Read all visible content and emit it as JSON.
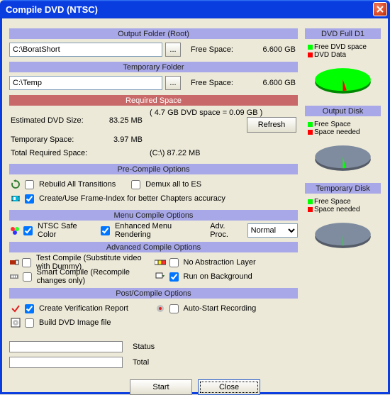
{
  "window": {
    "title": "Compile DVD (NTSC)"
  },
  "sections": {
    "output_folder": "Output Folder (Root)",
    "temp_folder": "Temporary Folder",
    "required_space": "Required Space",
    "pre_compile": "Pre-Compile Options",
    "menu_compile": "Menu Compile Options",
    "adv_compile": "Advanced Compile Options",
    "post_compile": "Post/Compile Options",
    "dvd_full": "DVD Full D1",
    "output_disk": "Output Disk",
    "temp_disk": "Temporary Disk"
  },
  "output_folder": {
    "path": "C:\\BoratShort",
    "free_space_label": "Free Space:",
    "free_space_value": "6.600 GB"
  },
  "temp_folder": {
    "path": "C:\\Temp",
    "free_space_label": "Free Space:",
    "free_space_value": "6.600 GB"
  },
  "required": {
    "est_label": "Estimated DVD Size:",
    "est_value": "83.25 MB",
    "est_extra": "( 4.7 GB DVD space = 0.09 GB )",
    "temp_label": "Temporary Space:",
    "temp_value": "3.97 MB",
    "total_label": "Total Required Space:",
    "total_value": "(C:\\) 87.22 MB",
    "refresh": "Refresh"
  },
  "pre": {
    "rebuild": "Rebuild All Transitions",
    "demux": "Demux all to ES",
    "frameindex": "Create/Use Frame-Index for better Chapters accuracy"
  },
  "menu": {
    "ntsc_safe": "NTSC Safe Color",
    "enh_render": "Enhanced Menu Rendering",
    "adv_proc_label": "Adv. Proc.",
    "adv_proc_value": "Normal"
  },
  "adv": {
    "test_compile": "Test Compile (Substitute video with Dummy)",
    "smart_compile": "Smart Compile (Recompile changes only)",
    "no_abstr": "No Abstraction Layer",
    "run_bg": "Run on Background"
  },
  "post": {
    "verif": "Create Verification Report",
    "autostart": "Auto-Start Recording",
    "build_iso": "Build DVD Image file"
  },
  "progress": {
    "status_label": "Status",
    "total_label": "Total"
  },
  "buttons": {
    "start": "Start",
    "close": "Close"
  },
  "legend": {
    "dvd_full_a": "Free DVD space",
    "dvd_full_b": "DVD Data",
    "out_a": "Free Space",
    "out_b": "Space needed",
    "tmp_a": "Free Space",
    "tmp_b": "Space needed"
  },
  "chart_data": [
    {
      "type": "pie",
      "title": "DVD Full D1",
      "series": [
        {
          "name": "Free DVD space",
          "value": 98.1,
          "color": "#00ff00"
        },
        {
          "name": "DVD Data",
          "value": 1.9,
          "color": "#ff0000"
        }
      ]
    },
    {
      "type": "pie",
      "title": "Output Disk",
      "series": [
        {
          "name": "Free Space",
          "value": 98.7,
          "color": "#7f8ca0"
        },
        {
          "name": "Space needed",
          "value": 1.3,
          "color": "#00ff00"
        }
      ]
    },
    {
      "type": "pie",
      "title": "Temporary Disk",
      "series": [
        {
          "name": "Free Space",
          "value": 99.9,
          "color": "#7f8ca0"
        },
        {
          "name": "Space needed",
          "value": 0.1,
          "color": "#00ff00"
        }
      ]
    }
  ],
  "checks": {
    "rebuild": false,
    "demux": false,
    "frameindex": true,
    "ntsc_safe": true,
    "enh_render": true,
    "test_compile": false,
    "smart_compile": false,
    "no_abstr": false,
    "run_bg": true,
    "verif": true,
    "autostart": false,
    "build_iso": false
  }
}
